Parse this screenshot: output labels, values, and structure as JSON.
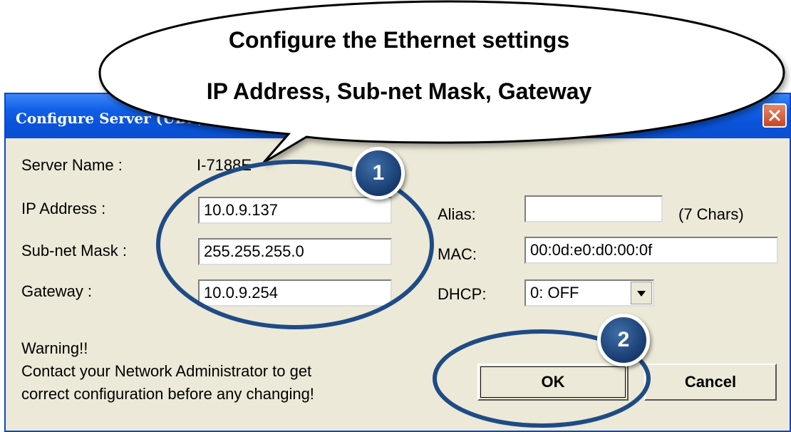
{
  "window": {
    "title": "Configure Server (UDP)"
  },
  "form": {
    "server_name_label": "Server Name :",
    "server_name_value": "I-7188E",
    "ip_label": "IP Address :",
    "ip_value": "10.0.9.137",
    "mask_label": "Sub-net Mask :",
    "mask_value": "255.255.255.0",
    "gateway_label": "Gateway :",
    "gateway_value": "10.0.9.254",
    "alias_label": "Alias:",
    "alias_value": "",
    "alias_hint": "(7 Chars)",
    "mac_label": "MAC:",
    "mac_value": "00:0d:e0:d0:00:0f",
    "dhcp_label": "DHCP:",
    "dhcp_value": "0: OFF"
  },
  "warning": {
    "title": "Warning!!",
    "line1": "Contact your Network Administrator to get",
    "line2": "correct  configuration before any changing!"
  },
  "buttons": {
    "ok_label": "OK",
    "cancel_label": "Cancel"
  },
  "callout": {
    "line1": "Configure the Ethernet settings",
    "line2": "IP Address, Sub-net Mask, Gateway"
  },
  "steps": {
    "step1": "1",
    "step2": "2"
  },
  "icons": {
    "close": "close-icon",
    "dropdown": "chevron-down-icon"
  },
  "colors": {
    "titlebar": "#0a52d8",
    "dialog_bg": "#ece9d8",
    "badge": "#1f4b85",
    "ring": "#1f4b85",
    "close_btn": "#c8451f"
  }
}
